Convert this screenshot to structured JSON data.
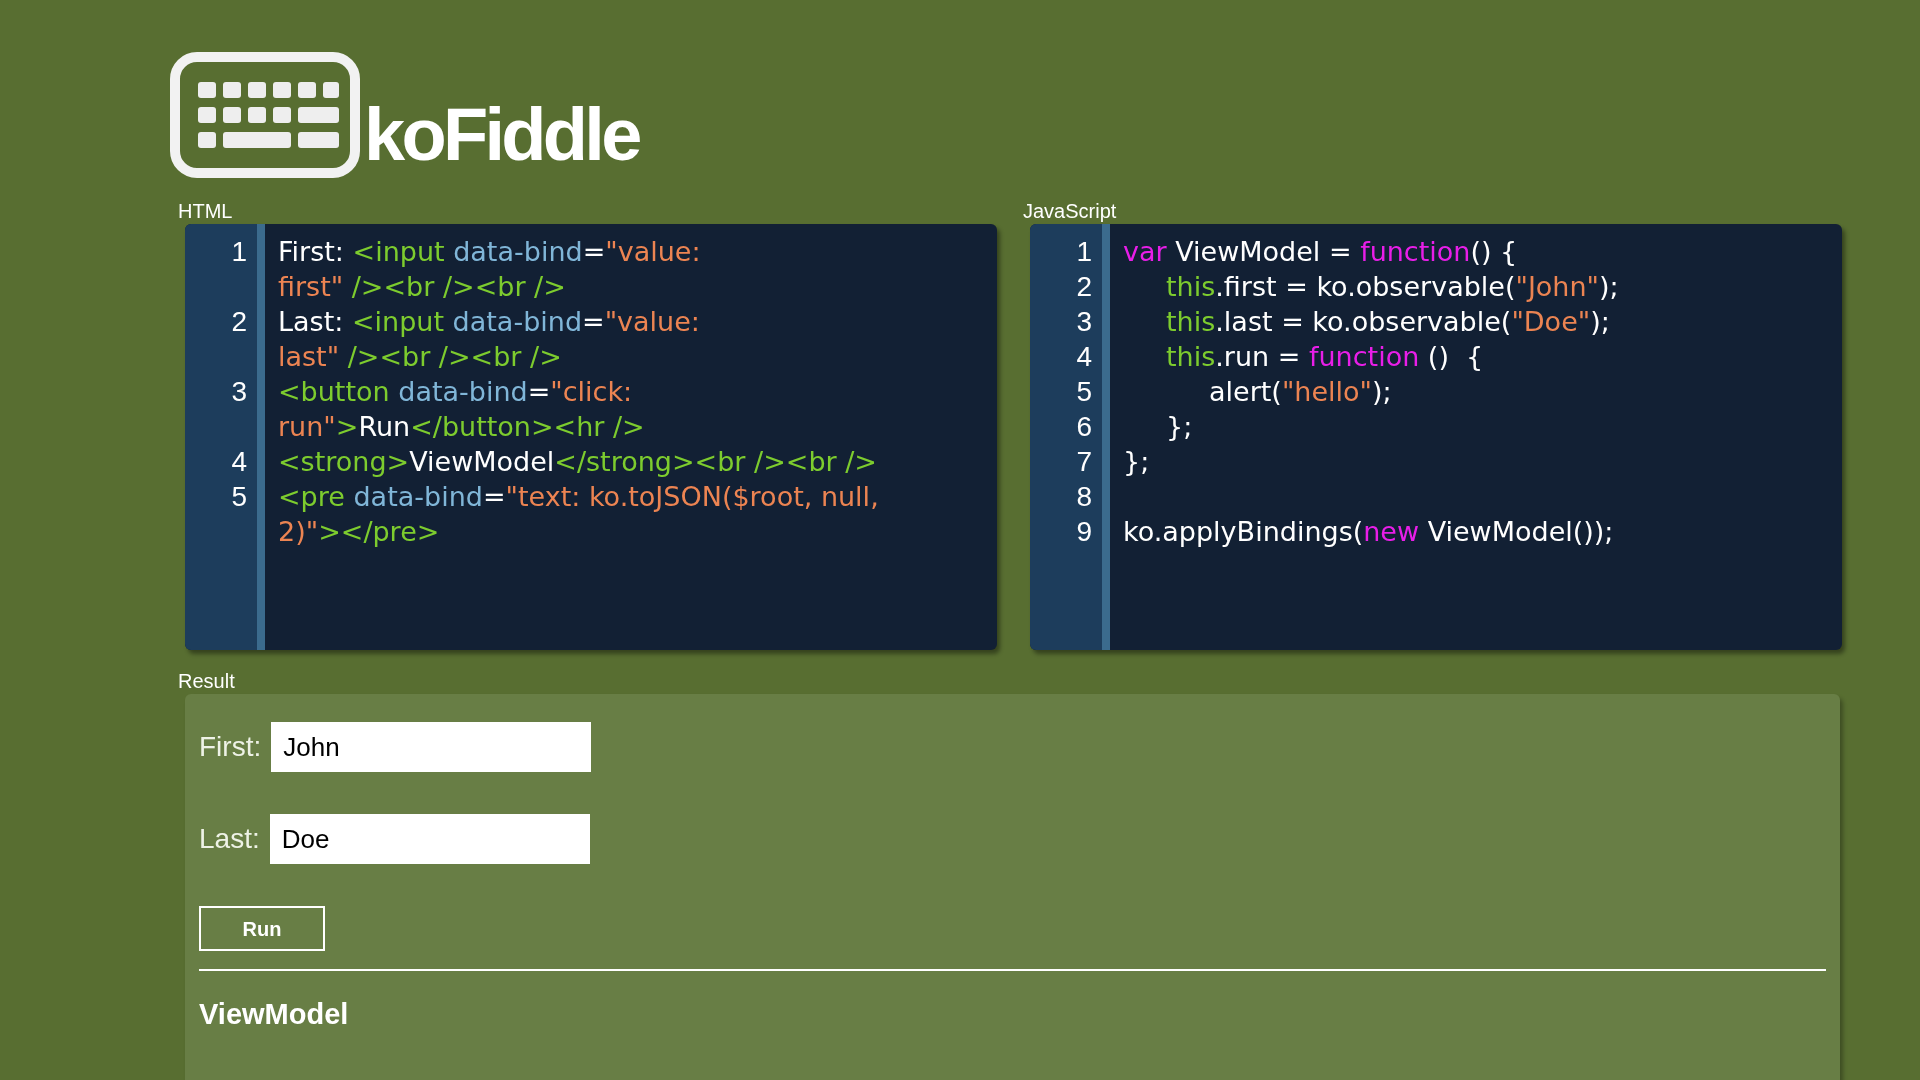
{
  "logo": {
    "text": "koFiddle"
  },
  "editors": [
    {
      "label": "HTML",
      "lines": [
        {
          "number": "1",
          "rows": [
            {
              "segments": [
                {
                  "kind": "plain",
                  "text": "First: "
                },
                {
                  "kind": "tag",
                  "text": "<input "
                },
                {
                  "kind": "attr",
                  "text": "data-bind"
                },
                {
                  "kind": "plain",
                  "text": "="
                },
                {
                  "kind": "string",
                  "text": "\"value:"
                }
              ]
            },
            {
              "segments": [
                {
                  "kind": "string",
                  "text": "first\""
                },
                {
                  "kind": "tag",
                  "text": " /><br /><br />"
                }
              ]
            }
          ]
        },
        {
          "number": "2",
          "rows": [
            {
              "segments": [
                {
                  "kind": "plain",
                  "text": "Last: "
                },
                {
                  "kind": "tag",
                  "text": "<input "
                },
                {
                  "kind": "attr",
                  "text": "data-bind"
                },
                {
                  "kind": "plain",
                  "text": "="
                },
                {
                  "kind": "string",
                  "text": "\"value:"
                }
              ]
            },
            {
              "segments": [
                {
                  "kind": "string",
                  "text": "last\""
                },
                {
                  "kind": "tag",
                  "text": " /><br /><br />"
                }
              ]
            }
          ]
        },
        {
          "number": "3",
          "rows": [
            {
              "segments": [
                {
                  "kind": "tag",
                  "text": "<button "
                },
                {
                  "kind": "attr",
                  "text": "data-bind"
                },
                {
                  "kind": "plain",
                  "text": "="
                },
                {
                  "kind": "string",
                  "text": "\"click:"
                }
              ]
            },
            {
              "segments": [
                {
                  "kind": "string",
                  "text": "run\""
                },
                {
                  "kind": "tag",
                  "text": ">"
                },
                {
                  "kind": "plain",
                  "text": "Run"
                },
                {
                  "kind": "tag",
                  "text": "</button><hr />"
                }
              ]
            }
          ]
        },
        {
          "number": "4",
          "rows": [
            {
              "segments": [
                {
                  "kind": "tag",
                  "text": "<strong>"
                },
                {
                  "kind": "plain",
                  "text": "ViewModel"
                },
                {
                  "kind": "tag",
                  "text": "</strong><br /><br />"
                }
              ]
            }
          ]
        },
        {
          "number": "5",
          "rows": [
            {
              "segments": [
                {
                  "kind": "tag",
                  "text": "<pre "
                },
                {
                  "kind": "attr",
                  "text": "data-bind"
                },
                {
                  "kind": "plain",
                  "text": "="
                },
                {
                  "kind": "string",
                  "text": "\"text: ko.toJSON($root, null,"
                }
              ]
            },
            {
              "segments": [
                {
                  "kind": "string",
                  "text": "2)\""
                },
                {
                  "kind": "tag",
                  "text": "></pre>"
                }
              ]
            }
          ]
        }
      ]
    },
    {
      "label": "JavaScript",
      "lines": [
        {
          "number": "1",
          "rows": [
            {
              "segments": [
                {
                  "kind": "keyword",
                  "text": "var"
                },
                {
                  "kind": "plain",
                  "text": " ViewModel = "
                },
                {
                  "kind": "keyword",
                  "text": "function"
                },
                {
                  "kind": "plain",
                  "text": "() {"
                }
              ]
            }
          ],
          "children": [
            {
              "number": "2",
              "rows": [
                {
                  "segments": [
                    {
                      "kind": "self",
                      "text": "this"
                    },
                    {
                      "kind": "plain",
                      "text": ".first = ko.observable("
                    },
                    {
                      "kind": "string",
                      "text": "\"John\""
                    },
                    {
                      "kind": "plain",
                      "text": ");"
                    }
                  ]
                }
              ]
            },
            {
              "number": "3",
              "rows": [
                {
                  "segments": [
                    {
                      "kind": "self",
                      "text": "this"
                    },
                    {
                      "kind": "plain",
                      "text": ".last = ko.observable("
                    },
                    {
                      "kind": "string",
                      "text": "\"Doe\""
                    },
                    {
                      "kind": "plain",
                      "text": ");"
                    }
                  ]
                }
              ]
            },
            {
              "number": "4",
              "rows": [
                {
                  "segments": [
                    {
                      "kind": "self",
                      "text": "this"
                    },
                    {
                      "kind": "plain",
                      "text": ".run = "
                    },
                    {
                      "kind": "keyword",
                      "text": "function"
                    },
                    {
                      "kind": "plain",
                      "text": " ()  {"
                    }
                  ]
                }
              ],
              "children": [
                {
                  "number": "5",
                  "rows": [
                    {
                      "segments": [
                        {
                          "kind": "plain",
                          "text": "alert("
                        },
                        {
                          "kind": "string",
                          "text": "\"hello\""
                        },
                        {
                          "kind": "plain",
                          "text": ");"
                        }
                      ]
                    }
                  ]
                }
              ]
            },
            {
              "number": "6",
              "rows": [
                {
                  "segments": [
                    {
                      "kind": "plain",
                      "text": "};"
                    }
                  ]
                }
              ]
            }
          ]
        },
        {
          "number": "7",
          "rows": [
            {
              "segments": [
                {
                  "kind": "plain",
                  "text": "};"
                }
              ]
            }
          ]
        },
        {
          "number": "8"
        },
        {
          "number": "9",
          "rows": [
            {
              "segments": [
                {
                  "kind": "plain",
                  "text": "ko.applyBindings("
                },
                {
                  "kind": "keyword",
                  "text": "new"
                },
                {
                  "kind": "plain",
                  "text": " ViewModel());"
                }
              ]
            }
          ]
        }
      ]
    }
  ],
  "result": {
    "label": "Result",
    "fields": [
      {
        "label": "First:",
        "value": "John"
      },
      {
        "label": "Last:",
        "value": "Doe"
      }
    ],
    "button": "Run",
    "heading": "ViewModel"
  }
}
